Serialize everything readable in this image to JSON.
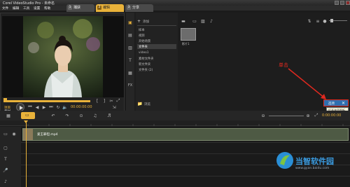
{
  "window": {
    "title": "Corel VideoStudio Pro - 未命名"
  },
  "menu": [
    "文件",
    "编辑",
    "工具",
    "设置",
    "帮助"
  ],
  "steps": [
    {
      "num": "1",
      "label": "捕获"
    },
    {
      "num": "2",
      "label": "编辑"
    },
    {
      "num": "3",
      "label": "分享"
    }
  ],
  "preview": {
    "timecode": "00:00:00:00",
    "project_label": "项目",
    "clip_label": "素材"
  },
  "library": {
    "add_label": "添加",
    "folders": [
      "样本",
      "视频",
      "开始场景",
      "文件夹",
      "video1",
      "素材文件夹",
      "新文件夹",
      "文件夹 (2)"
    ],
    "selected_folder_index": 3,
    "browse_label": "浏览",
    "thumb_label": "影片1"
  },
  "annotation": {
    "text": "单击"
  },
  "options_button": {
    "label": "选项",
    "tooltip": "打开选项面板"
  },
  "timeline": {
    "clip_name": "爱王罪但.mp4",
    "duration": "0:00:00:00"
  },
  "colors": {
    "accent_yellow": "#e9b23a",
    "annotation_red": "#e0291f",
    "button_blue": "#2f6fb0",
    "clip_green": "#4e5a44"
  },
  "watermark": {
    "site": "当智软件园",
    "url": "www.gyan.baidu.com"
  }
}
